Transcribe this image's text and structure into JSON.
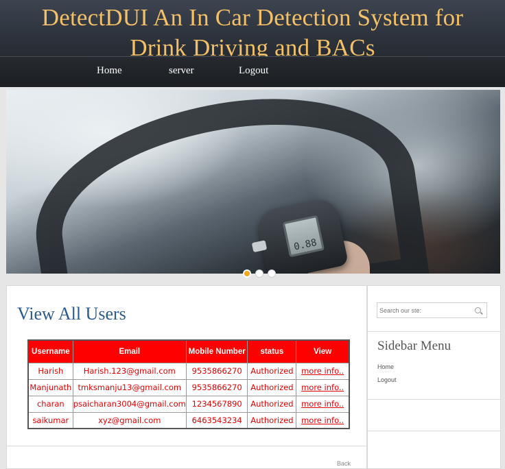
{
  "header": {
    "title_line1": "DetectDUI An In Car Detection System for",
    "title_line2": "Drink Driving and BACs"
  },
  "nav": {
    "items": [
      {
        "label": "Home"
      },
      {
        "label": "server"
      },
      {
        "label": "Logout"
      }
    ]
  },
  "hero": {
    "device_reading": "0.88",
    "slide_count": 3,
    "active_slide": 1
  },
  "main": {
    "heading": "View All Users",
    "table": {
      "headers": [
        "Username",
        "Email",
        "Mobile Number",
        "status",
        "View"
      ],
      "rows": [
        {
          "username": "Harish",
          "email": "Harish.123@gmail.com",
          "mobile": "9535866270",
          "status": "Authorized",
          "view": "more info.."
        },
        {
          "username": "Manjunath",
          "email": "tmksmanju13@gmail.com",
          "mobile": "9535866270",
          "status": "Authorized",
          "view": "more info.."
        },
        {
          "username": "charan",
          "email": "psaicharan3004@gmail.com",
          "mobile": "1234567890",
          "status": "Authorized",
          "view": "more info.."
        },
        {
          "username": "saikumar",
          "email": "xyz@gmail.com",
          "mobile": "6463543234",
          "status": "Authorized",
          "view": "more info.."
        }
      ]
    },
    "back_label": "Back"
  },
  "sidebar": {
    "search_placeholder": "Search our ste:",
    "heading": "Sidebar Menu",
    "links": [
      {
        "label": "Home"
      },
      {
        "label": "Logout"
      }
    ]
  },
  "colors": {
    "title_gold": "#f3c067",
    "table_header_red": "#ff0000",
    "table_text_red": "#e10000",
    "heading_blue": "#2b5a8f",
    "active_dot": "#f0a81e"
  }
}
